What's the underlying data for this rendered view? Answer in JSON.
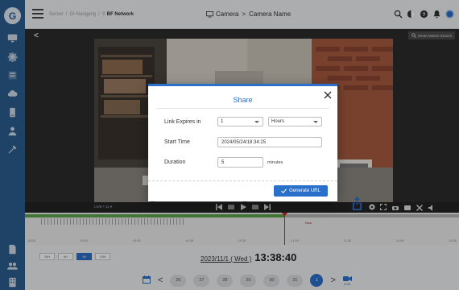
{
  "app": {
    "logo_letter": "G"
  },
  "breadcrumb": {
    "items": [
      "Server",
      "GI-Nangang",
      "BF Network"
    ]
  },
  "header": {
    "camera_prefix": "Camera",
    "camera_name": "Camera Name"
  },
  "video": {
    "smart_search_label": "Smart Motion Search",
    "live_label": "LIVE",
    "speed_label": "1x"
  },
  "share_modal": {
    "title": "Share",
    "link_expires_label": "Link Expires in",
    "link_expires_value": "1",
    "link_expires_unit": "Hours",
    "start_time_label": "Start Time",
    "start_time_value": "2024/05/24/18:34:25",
    "duration_label": "Duration",
    "duration_value": "5",
    "duration_unit": "minutes",
    "generate_label": "Generate URL"
  },
  "timeline": {
    "now_label": "Now",
    "ticks": [
      "10:00",
      "10:15",
      "10:30",
      "10:45",
      "11:00",
      "11:15",
      "11:30",
      "11:45",
      "12:00"
    ],
    "progress_fraction": 0.597
  },
  "bottom": {
    "zoom_options": [
      "24H",
      "6H",
      "1H",
      "10M"
    ],
    "zoom_active": "1H",
    "date": "2023/11/1 ( Wed )",
    "time": "13:38:40",
    "days": [
      "26",
      "27",
      "28",
      "29",
      "30",
      "31",
      "1"
    ],
    "day_active": "1",
    "live_badge": "LIVE"
  },
  "colors": {
    "brand": "#2a6fc9",
    "sidebar": "#2a5d8e",
    "recording": "#5aa24a",
    "event": "#d9a04c",
    "now_marker": "#cc2b2b"
  },
  "icons": {
    "sidebar": [
      "monitor-icon",
      "gear-icon",
      "device-icon",
      "cloud-icon",
      "phone-icon",
      "user-icon",
      "tools-icon",
      "file-icon",
      "users-icon",
      "building-icon"
    ],
    "top": [
      "search-icon",
      "contrast-icon",
      "help-icon",
      "bell-icon",
      "status-dot-icon"
    ]
  }
}
